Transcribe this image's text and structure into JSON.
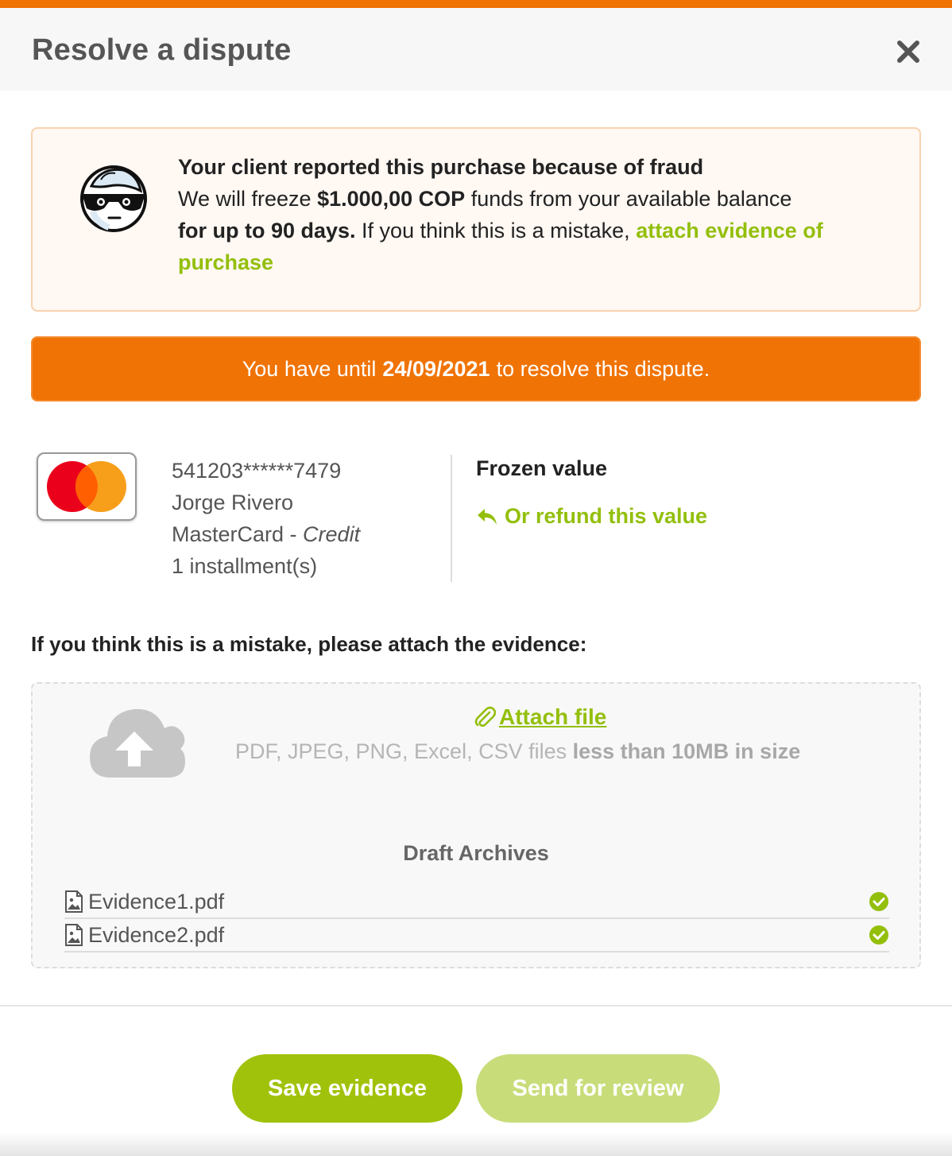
{
  "header": {
    "title": "Resolve a dispute"
  },
  "fraud_notice": {
    "title": "Your client reported this purchase because of fraud",
    "line_prefix": "We will freeze ",
    "amount": "$1.000,00 COP",
    "line_suffix": " funds from your available balance",
    "duration": "for up to 90 days.",
    "mistake_text": " If you think this is a mistake, ",
    "link_text": "attach evidence of purchase"
  },
  "deadline": {
    "prefix": "You have until",
    "date": "24/09/2021",
    "suffix": "to resolve this dispute."
  },
  "card": {
    "number": "541203******7479",
    "holder": "Jorge Rivero",
    "brand": "MasterCard - ",
    "type": "Credit",
    "installments": "1 installment(s)"
  },
  "frozen": {
    "label": "Frozen value",
    "refund_link": "Or refund this value"
  },
  "evidence": {
    "heading": "If you think this is a mistake, please attach the evidence:",
    "attach_link": "Attach file",
    "hint_prefix": "PDF, JPEG, PNG, Excel, CSV files ",
    "hint_bold": "less than 10MB in size",
    "draft_title": "Draft Archives",
    "files": [
      {
        "name": "Evidence1.pdf"
      },
      {
        "name": "Evidence2.pdf"
      }
    ]
  },
  "actions": {
    "save_label": "Save evidence",
    "send_label": "Send for review"
  },
  "colors": {
    "accent_orange": "#f07305",
    "accent_green": "#93bf0b",
    "button_green": "#a0c20b",
    "button_green_disabled": "#c8dd7a"
  },
  "icons": [
    "close-icon",
    "fraud-thief-icon",
    "mastercard-logo",
    "reply-arrow-icon",
    "cloud-upload-icon",
    "paperclip-icon",
    "image-file-icon",
    "check-circle-icon"
  ]
}
